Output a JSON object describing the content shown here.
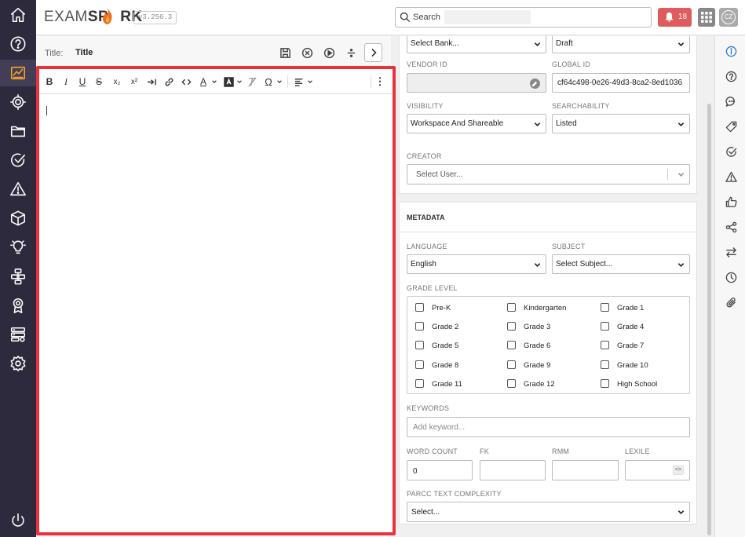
{
  "app": {
    "logo_text_left": "EXAM",
    "logo_text_right": "SP",
    "logo_text_end": "RK",
    "version": "v3.256.3"
  },
  "leftnav": {
    "items": [
      {
        "name": "home-icon"
      },
      {
        "name": "help-icon"
      },
      {
        "name": "chart-icon",
        "active": true
      },
      {
        "name": "target-icon"
      },
      {
        "name": "folder-icon"
      },
      {
        "name": "check-circle-icon"
      },
      {
        "name": "warning-icon"
      },
      {
        "name": "cube-icon"
      },
      {
        "name": "lightbulb-icon"
      },
      {
        "name": "sitemap-icon"
      },
      {
        "name": "award-icon"
      },
      {
        "name": "server-settings-icon"
      },
      {
        "name": "gear-icon"
      },
      {
        "name": "power-icon"
      }
    ],
    "accent_color": "#f5a623"
  },
  "header": {
    "search_placeholder": "Search",
    "notification_count": "18",
    "user_initials": "CZ"
  },
  "editor": {
    "title_label": "Title:",
    "title_value": "Title",
    "toolbar": [
      "bold",
      "italic",
      "underline",
      "strikethrough",
      "subscript",
      "superscript",
      "indent",
      "link",
      "code",
      "font-color",
      "highlight",
      "clear-format",
      "special-char",
      "align",
      "more"
    ],
    "toolbar_labels": {
      "bold": "B",
      "italic": "I",
      "underline": "U",
      "strike": "S",
      "sub": "x₂",
      "sup": "x²",
      "font_color": "A",
      "omega": "Ω",
      "more": "⋮"
    },
    "highlight_color": "#e8323c"
  },
  "properties": {
    "bank_select": "Select Bank...",
    "status_select": "Draft",
    "vendor_id_label": "VENDOR ID",
    "vendor_id_value": "",
    "global_id_label": "GLOBAL ID",
    "global_id_value": "cf64c498-0e26-49d3-8ca2-8ed1036",
    "visibility_label": "VISIBILITY",
    "visibility_value": "Workspace And Shareable",
    "searchability_label": "SEARCHABILITY",
    "searchability_value": "Listed",
    "creator_label": "CREATOR",
    "creator_placeholder": "Select User..."
  },
  "metadata": {
    "heading": "METADATA",
    "language_label": "LANGUAGE",
    "language_value": "English",
    "subject_label": "SUBJECT",
    "subject_value": "Select Subject...",
    "grade_level_label": "GRADE LEVEL",
    "grades": [
      "Pre-K",
      "Kindergarten",
      "Grade 1",
      "Grade 2",
      "Grade 3",
      "Grade 4",
      "Grade 5",
      "Grade 6",
      "Grade 7",
      "Grade 8",
      "Grade 9",
      "Grade 10",
      "Grade 11",
      "Grade 12",
      "High School"
    ],
    "keywords_label": "KEYWORDS",
    "keywords_placeholder": "Add keyword...",
    "word_count_label": "WORD COUNT",
    "word_count_value": "0",
    "fk_label": "FK",
    "fk_value": "",
    "rmm_label": "RMM",
    "rmm_value": "",
    "lexile_label": "LEXILE",
    "lexile_value": "",
    "lexile_button": "<>",
    "parcc_label": "PARCC TEXT COMPLEXITY",
    "parcc_value": "Select..."
  },
  "right_rail": {
    "items": [
      {
        "name": "info-icon",
        "active": true
      },
      {
        "name": "question-icon"
      },
      {
        "name": "comment-icon"
      },
      {
        "name": "tag-icon"
      },
      {
        "name": "check-circle-icon"
      },
      {
        "name": "warning-icon"
      },
      {
        "name": "thumbs-up-icon"
      },
      {
        "name": "share-icon"
      },
      {
        "name": "swap-icon"
      },
      {
        "name": "clock-icon"
      },
      {
        "name": "paperclip-icon"
      }
    ]
  }
}
